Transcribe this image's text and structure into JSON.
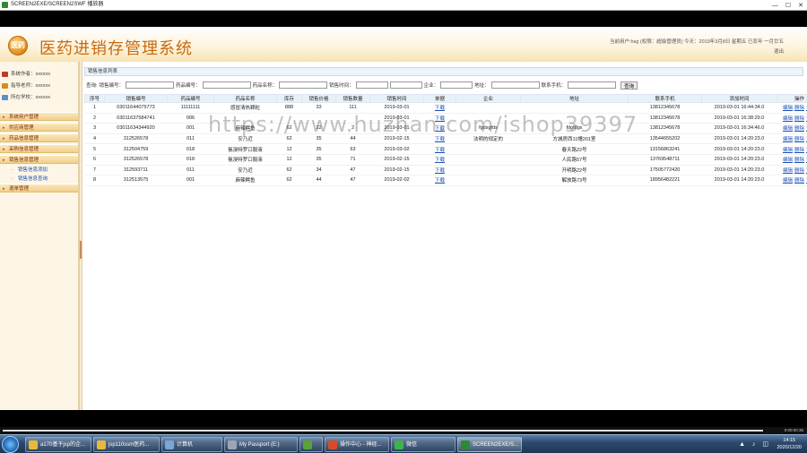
{
  "window": {
    "title": "SCREEN2EXE/SCREEN2SWF 播放器"
  },
  "header": {
    "title": "医药进销存管理系统",
    "logo_text": "医药",
    "user_line1": "当前用户:hsg (权限：超级管理员) 今天：2019年3月8日 星期五 已农年 一月廿五",
    "logout": "退出"
  },
  "sidebar": {
    "info": [
      {
        "label": "系统作者：xxxxxx",
        "icon": "user-icon",
        "color": "#c0392b"
      },
      {
        "label": "指导老师：xxxxxx",
        "icon": "teacher-icon",
        "color": "#d98a1a"
      },
      {
        "label": "所在学校：xxxxxx",
        "icon": "school-icon",
        "color": "#5a8fd0"
      }
    ],
    "menus": [
      "系统用户管理",
      "供应商管理",
      "药品信息管理",
      "采购信息管理",
      "销售信息管理",
      "退单管理"
    ],
    "submenus": [
      "销售信息添加",
      "销售信息查询"
    ]
  },
  "panel": {
    "title": "销售信息列表"
  },
  "search": {
    "query_label": "查询:",
    "fields": [
      "销售编号：",
      "药品编号：",
      "药品名称：",
      "销售时间：",
      "企业：",
      "地址：",
      "联系手机："
    ],
    "button": "查询"
  },
  "table": {
    "headers": [
      "序号",
      "销售编号",
      "药品编号",
      "药品名称",
      "库存",
      "销售价格",
      "销售数量",
      "销售时间",
      "单据",
      "企业",
      "地址",
      "联系手机",
      "添加时间",
      "操作"
    ],
    "rows": [
      [
        "1",
        "03011644075773",
        "11111111",
        "感冒清热颗粒",
        "888",
        "33",
        "111",
        "2019-03-01",
        "下载",
        "",
        "",
        "13812345678",
        "2019-03-01 16:44:34.0"
      ],
      [
        "2",
        "03011637584741",
        "006",
        "",
        "",
        "",
        "",
        "2019-03-01",
        "下载",
        "",
        "",
        "13812345678",
        "2019-03-01 16:38:29.0"
      ],
      [
        "3",
        "03011634344920",
        "001",
        "麻辣鳄鱼",
        "62",
        "22",
        "2",
        "2019-03-01",
        "下载",
        "fgdsgfds",
        "fdgfdgx",
        "13812345678",
        "2019-03-01 16:34:46.0"
      ],
      [
        "4",
        "312526578",
        "011",
        "安乃近",
        "62",
        "35",
        "44",
        "2019-02-15",
        "下载",
        "法明的规定的",
        "方城房西11幢201室",
        "13544655202",
        "2019-03-01 14:20:23.0"
      ],
      [
        "5",
        "312504759",
        "018",
        "氨溴特罗口服液",
        "12",
        "35",
        "63",
        "2019-03-02",
        "下载",
        "",
        "春天路22号",
        "13156863241",
        "2019-03-01 14:20:23.0"
      ],
      [
        "6",
        "312526578",
        "018",
        "氨溴特罗口服液",
        "12",
        "35",
        "71",
        "2019-02-15",
        "下载",
        "",
        "人民路57号",
        "13769548711",
        "2019-03-01 14:20:23.0"
      ],
      [
        "7",
        "312593711",
        "011",
        "安乃近",
        "62",
        "34",
        "47",
        "2019-02-15",
        "下载",
        "",
        "开明路22号",
        "17505772420",
        "2019-03-01 14:20:23.0"
      ],
      [
        "8",
        "312513575",
        "001",
        "麻辣鳄鱼",
        "62",
        "44",
        "47",
        "2019-02-02",
        "下载",
        "",
        "解放路73号",
        "18956482221",
        "2019-03-01 14:20:23.0"
      ]
    ],
    "ops": [
      "编辑",
      "删除",
      "详细"
    ]
  },
  "watermark": "https://www.huzhan.com/ishop39397",
  "player": {
    "time": "0:00:00:35"
  },
  "taskbar": {
    "items": [
      {
        "label": "a170基于jsp的企...",
        "color": "#e8b93a"
      },
      {
        "label": "jsp110ssm医药...",
        "color": "#e8b93a"
      },
      {
        "label": "计算机",
        "color": "#7aa6d8"
      },
      {
        "label": "My Passport (E:)",
        "color": "#9aa6b3"
      },
      {
        "label": "",
        "color": "#5aa13a"
      },
      {
        "label": "操作中心 - 神经...",
        "color": "#d94a2a"
      },
      {
        "label": "微信",
        "color": "#3bb54a"
      },
      {
        "label": "SCREEN2EXE/S...",
        "color": "#2a8a3a"
      }
    ],
    "time": "14:15",
    "date": "2020/12/20"
  }
}
